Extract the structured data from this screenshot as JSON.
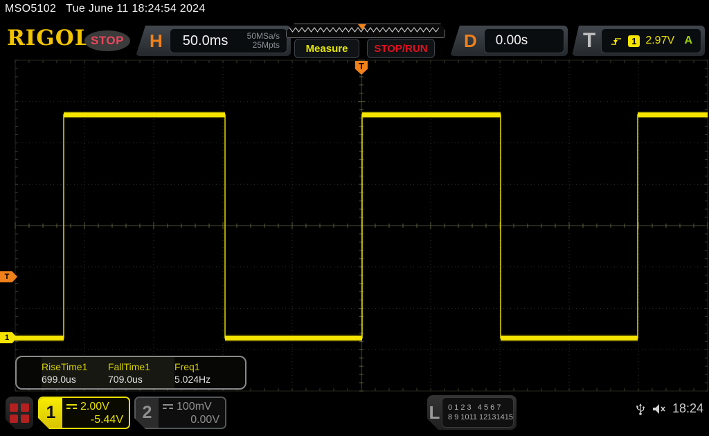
{
  "title_bar": {
    "model": "MSO5102",
    "datetime": "Tue June 11 18:24:54 2024"
  },
  "header": {
    "logo": "RIGOL",
    "acq_status": "STOP",
    "horizontal": {
      "label": "H",
      "timebase": "50.0ms",
      "sample_rate": "50MSa/s",
      "mem_depth": "25Mpts"
    },
    "measure_label": "Measure",
    "stoprun_label": "STOP/RUN",
    "delay": {
      "label": "D",
      "value": "0.00s"
    },
    "trigger": {
      "label": "T",
      "source_badge": "1",
      "level": "2.97V",
      "mode": "A",
      "edge_icon": "rising-edge-icon"
    }
  },
  "markers": {
    "trigger_position": "T",
    "trigger_level": "T",
    "channel1": "1"
  },
  "measurements": {
    "items": [
      {
        "name": "RiseTime1",
        "value": "699.0us"
      },
      {
        "name": "FallTime1",
        "value": "709.0us"
      },
      {
        "name": "Freq1",
        "value": "5.024Hz"
      }
    ]
  },
  "bottom_bar": {
    "ch1": {
      "badge": "1",
      "scale": "2.00V",
      "offset": "-5.44V"
    },
    "ch2": {
      "badge": "2",
      "scale": "100mV",
      "offset": "0.00V"
    },
    "logic": {
      "label": "L",
      "row1": "0 1 2 3   4 5 6 7",
      "row2": "8 9 1011 12131415"
    },
    "time": "18:24"
  },
  "colors": {
    "waveform_yellow": "#f5e400",
    "accent_orange": "#f08019",
    "stop_red": "#e01020",
    "trigger_mode_green": "#9ed400",
    "measure_yellow": "#e6e600"
  },
  "chart_data": {
    "type": "line",
    "channel": "CH1",
    "title": "CH1 square wave",
    "x_units": "ms",
    "y_units": "V",
    "timebase_per_div": "50.0ms",
    "sample_rate": "50MSa/s",
    "mem_depth": "25Mpts",
    "x_range": [
      -250,
      250
    ],
    "volts_per_div": 2.0,
    "vertical_offset_v": -5.44,
    "trigger_level_v": 2.97,
    "high_level_v": 10.8,
    "low_level_v": 0.0,
    "measured": {
      "rise_time": "699.0us",
      "fall_time": "709.0us",
      "frequency": "5.024Hz"
    },
    "segments": [
      {
        "t0": -250.0,
        "t1": -215.0,
        "level_v": 0.0
      },
      {
        "t0": -215.0,
        "t1": -98.5,
        "level_v": 10.8
      },
      {
        "t0": -98.5,
        "t1": 0.5,
        "level_v": 0.0
      },
      {
        "t0": 0.5,
        "t1": 100.5,
        "level_v": 10.8
      },
      {
        "t0": 100.5,
        "t1": 199.5,
        "level_v": 0.0
      },
      {
        "t0": 199.5,
        "t1": 250.0,
        "level_v": 10.8
      }
    ]
  }
}
